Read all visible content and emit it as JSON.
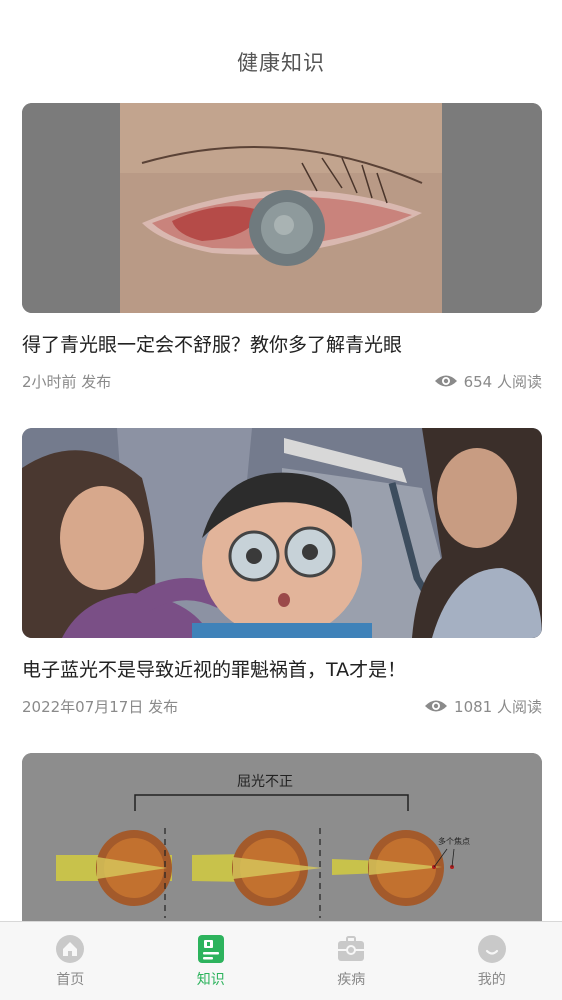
{
  "header": {
    "title": "健康知识"
  },
  "articles": [
    {
      "title": "得了青光眼一定会不舒服？教你多了解青光眼",
      "time": "2小时前 发布",
      "reads": "654 人阅读",
      "image": "red-eye-photo"
    },
    {
      "title": "电子蓝光不是导致近视的罪魁祸首，TA才是！",
      "time": "2022年07月17日 发布",
      "reads": "1081 人阅读",
      "image": "eye-exam-illustration"
    },
    {
      "title": "",
      "time": "",
      "reads": "",
      "image": "refraction-diagram",
      "image_text": {
        "heading": "屈光不正",
        "note": "多个焦点"
      }
    }
  ],
  "tabbar": {
    "items": [
      {
        "label": "首页",
        "icon": "home-icon",
        "active": false
      },
      {
        "label": "知识",
        "icon": "knowledge-icon",
        "active": true
      },
      {
        "label": "疾病",
        "icon": "medical-kit-icon",
        "active": false
      },
      {
        "label": "我的",
        "icon": "profile-icon",
        "active": false
      }
    ]
  },
  "colors": {
    "accent": "#2db35d",
    "inactive": "#8a8a8a",
    "title": "#222222",
    "meta": "#8a8a8a"
  }
}
